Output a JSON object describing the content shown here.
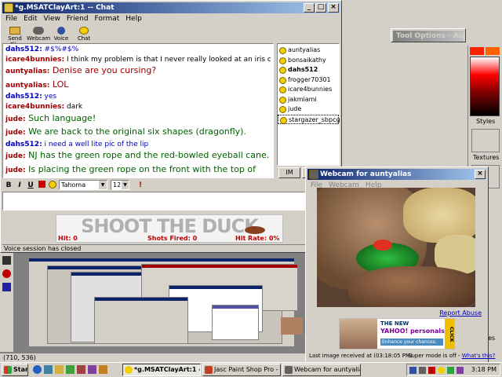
{
  "chat_window": {
    "title": "*g.MSATClayArt:1 -- Chat",
    "menu": [
      "File",
      "Edit",
      "View",
      "Friend",
      "Format",
      "Help"
    ],
    "toolbar": [
      "Send File",
      "Webcam",
      "Voice",
      "Chat"
    ],
    "messages": [
      {
        "user": "dahs512:",
        "text": "#$%#$%",
        "ucolor": "blue",
        "tcolor": "blue",
        "size": "small"
      },
      {
        "user": "icare4bunnies:",
        "text": "I think my problem is that I never really looked at an iris closely",
        "ucolor": "red",
        "tcolor": "black",
        "size": "small"
      },
      {
        "user": "auntyalias:",
        "text": "Denise are you cursing?",
        "ucolor": "red",
        "tcolor": "red",
        "size": "big"
      },
      {
        "user": "auntyalias:",
        "text": "LOL",
        "ucolor": "red",
        "tcolor": "red",
        "size": "big"
      },
      {
        "user": "dahs512:",
        "text": "yes",
        "ucolor": "blue",
        "tcolor": "blue",
        "size": "small"
      },
      {
        "user": "icare4bunnies:",
        "text": "dark",
        "ucolor": "red",
        "tcolor": "black",
        "size": "small"
      },
      {
        "user": "jude:",
        "text": "Such language!",
        "ucolor": "red",
        "tcolor": "green",
        "size": "big"
      },
      {
        "user": "jude:",
        "text": "We are back to the original six shapes (dragonfly).",
        "ucolor": "red",
        "tcolor": "green",
        "size": "big"
      },
      {
        "user": "dahs512:",
        "text": "i need a well lite pic of the lip",
        "ucolor": "blue",
        "tcolor": "blue",
        "size": "small"
      },
      {
        "user": "jude:",
        "text": "NJ has the green rope and the red-bowled eyeball cane.",
        "ucolor": "red",
        "tcolor": "green",
        "size": "big"
      },
      {
        "user": "jude:",
        "text": "Is placing the green rope on the front with the top of",
        "ucolor": "red",
        "tcolor": "green",
        "size": "big"
      },
      {
        "user": "",
        "text": " the rope just touching the red bowls.",
        "ucolor": "red",
        "tcolor": "green",
        "size": "big"
      }
    ],
    "users": [
      "auntyalias",
      "bonsaikathy",
      "dahs512",
      "frogger70301",
      "icare4bunnies",
      "jakmiami",
      "jude",
      "stargazer_sbpcg"
    ],
    "bold_user": "dahs512",
    "selected_user": "stargazer_sbpcg",
    "im_button": "IM",
    "font_name": "Tahoma",
    "font_size": "12",
    "input_value": "",
    "ad": {
      "title": "SHOOT THE DUCK",
      "hit": "Hit: 0",
      "shots": "Shots Fired: 0",
      "rate": "Hit Rate: 0%"
    },
    "status": "Voice session has closed"
  },
  "tool_options": {
    "title": "Tool Options - Airbru"
  },
  "psp_panel": {
    "styles": "Styles",
    "textures": "Textures"
  },
  "webcam_window": {
    "title": "Webcam for auntyalias",
    "menu": [
      "File",
      "Webcam",
      "Help"
    ],
    "report": "Report Abuse",
    "last_image": "Last image received at (03:18:05 PM)",
    "super_mode": "Super mode is off -",
    "whats_this": "What's this?",
    "yahoo_ad": {
      "the_new": "THE NEW",
      "brand": "YAHOO! personals",
      "tagline": "Enhance your chances.",
      "click": "CLICK"
    }
  },
  "psp_coords": "(710, 536)",
  "psp_tail": "tes",
  "taskbar": {
    "start": "Start",
    "buttons": [
      "*g.MSATClayArt:1 -- ...",
      "Jasc Paint Shop Pro - Ima...",
      "Webcam for auntyalias"
    ],
    "clock": "3:18 PM"
  },
  "colors": {
    "desktop": "#3a6ea5",
    "title_active": "#0a246a",
    "face": "#d4d0c8"
  }
}
